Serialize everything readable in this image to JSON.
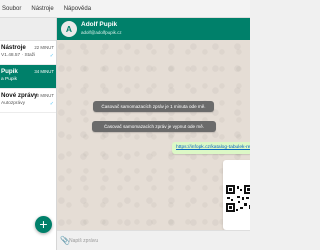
{
  "menu": {
    "items": [
      "Soubor",
      "Nástroje",
      "Nápověda"
    ]
  },
  "chats": [
    {
      "name": "Nástroje",
      "time": "22 MINUT",
      "snippet": "V1.48.57 · Staži",
      "active": false,
      "check": "✓"
    },
    {
      "name": "Pupik",
      "time": "34 MINUT",
      "snippet": "a Pupik",
      "active": true,
      "check": ""
    },
    {
      "name": "Nové zprávy",
      "time": "40 MINUT",
      "snippet": "Autozprávy",
      "active": false,
      "check": "✓"
    }
  ],
  "new_chat_icon": "+",
  "conversation": {
    "avatar_letter": "A",
    "name": "Adolf Pupik",
    "email": "adolf@adolfpupik.cz"
  },
  "messages": {
    "system": [
      "Časovač samomazacích zpráv je 1 minuta ode mě.",
      "Časovač samomazacích zpráv je vypnut ode mě."
    ],
    "link": "https://infopk.cz/katalog-tabulek-reklam"
  },
  "composer": {
    "attach_icon": "paperclip-icon",
    "placeholder": "Napiš zprávu"
  },
  "colors": {
    "accent": "#00806a",
    "bubble_out": "#dcf8c6",
    "system_bubble": "#6b6b6b",
    "chat_bg": "#e5ddd5"
  }
}
